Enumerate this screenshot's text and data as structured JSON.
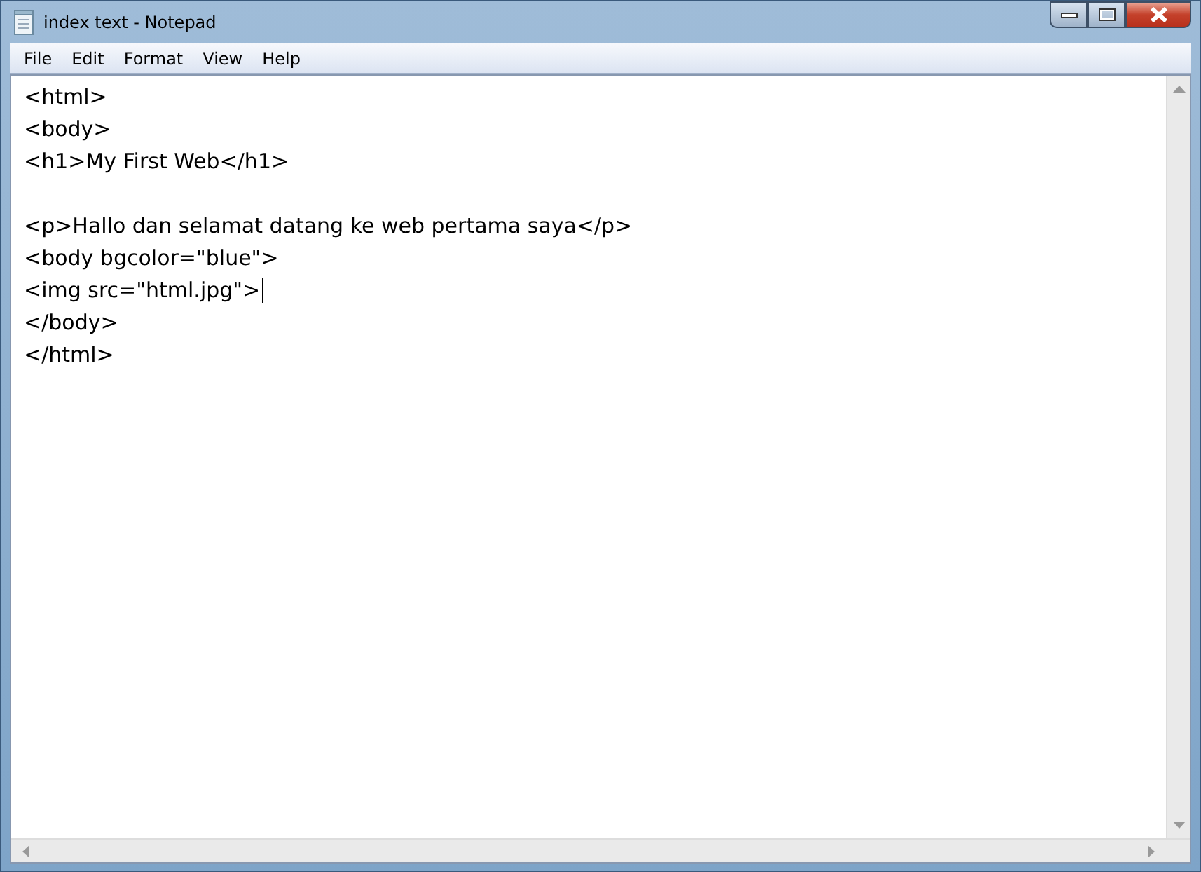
{
  "window": {
    "title": "index text - Notepad"
  },
  "menu": [
    "File",
    "Edit",
    "Format",
    "View",
    "Help"
  ],
  "editor": {
    "blocks": [
      [
        {
          "text": "<html>",
          "caret": false
        },
        {
          "text": "<body>",
          "caret": false
        },
        {
          "text": "<h1>My First Web</h1>",
          "caret": false
        }
      ],
      [
        {
          "text": "<p>Hallo dan selamat datang ke web pertama saya</p>",
          "caret": false
        },
        {
          "text": "<body bgcolor=\"blue\">",
          "caret": false
        },
        {
          "text": "<img src=\"html.jpg\">",
          "caret": true
        },
        {
          "text": "</body>",
          "caret": false
        },
        {
          "text": "</html>",
          "caret": false
        }
      ]
    ]
  }
}
